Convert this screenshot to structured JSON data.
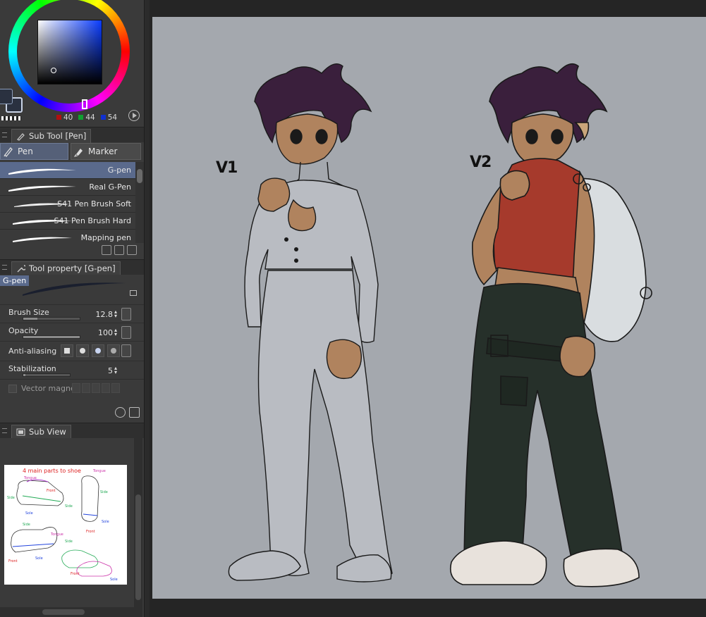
{
  "color_panel": {
    "rgb": {
      "r": "40",
      "g": "44",
      "b": "54"
    },
    "colors": {
      "main": "#2a3140",
      "r_chip": "#b01010",
      "g_chip": "#10a030",
      "b_chip": "#1030d0"
    }
  },
  "subtool_panel": {
    "title": "Sub Tool [Pen]",
    "tabs": [
      {
        "label": "Pen",
        "icon": "pen-icon"
      },
      {
        "label": "Marker",
        "icon": "marker-icon"
      }
    ],
    "brushes": [
      {
        "name": "G-pen"
      },
      {
        "name": "Real G-Pen"
      },
      {
        "name": "S41 Pen Brush Soft"
      },
      {
        "name": "S41 Pen Brush Hard"
      },
      {
        "name": "Mapping pen"
      }
    ]
  },
  "tool_property": {
    "title": "Tool property [G-pen]",
    "brush_label": "G-pen",
    "brush_size": {
      "label": "Brush Size",
      "value": "12.8",
      "fill": 0.25
    },
    "opacity": {
      "label": "Opacity",
      "value": "100",
      "fill": 1.0
    },
    "anti_aliasing": {
      "label": "Anti-aliasing",
      "selected_index": 2
    },
    "stabilization": {
      "label": "Stabilization",
      "value": "5",
      "fill": 0.05
    },
    "vector_magnet": {
      "label": "Vector magnet"
    }
  },
  "subview": {
    "title": "Sub View",
    "reference_caption": "4 main parts to shoe",
    "reference_labels": [
      "Tongue",
      "Side",
      "Front",
      "Sole",
      "Side",
      "Tongue",
      "Side",
      "Front",
      "Sole",
      "Side",
      "Tongue",
      "Front",
      "Sole",
      "Side",
      "Front",
      "Sole"
    ]
  },
  "canvas": {
    "labels": {
      "v1": "V1",
      "v2": "V2"
    },
    "colors": {
      "background": "#a4a8ae",
      "skin": "#b0835e",
      "hair": "#3a1f3c",
      "top_v2": "#a63a2c",
      "pants_v2": "#26302a",
      "shoes_v2": "#e8e2dc"
    }
  }
}
